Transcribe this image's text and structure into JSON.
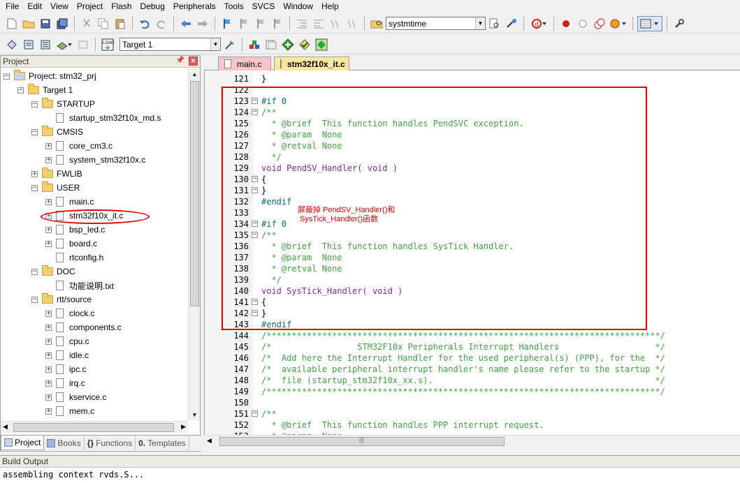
{
  "menu": [
    "File",
    "Edit",
    "View",
    "Project",
    "Flash",
    "Debug",
    "Peripherals",
    "Tools",
    "SVCS",
    "Window",
    "Help"
  ],
  "toolbar": {
    "find_combo": "systmtime",
    "target_combo": "Target 1"
  },
  "project_panel": {
    "title": "Project",
    "tree": [
      {
        "label": "Project: stm32_prj",
        "level": 0,
        "kind": "project"
      },
      {
        "label": "Target 1",
        "level": 1,
        "kind": "target"
      },
      {
        "label": "STARTUP",
        "level": 2,
        "kind": "folder"
      },
      {
        "label": "startup_stm32f10x_md.s",
        "level": 3,
        "kind": "file"
      },
      {
        "label": "CMSIS",
        "level": 2,
        "kind": "folder"
      },
      {
        "label": "core_cm3.c",
        "level": 3,
        "kind": "file"
      },
      {
        "label": "system_stm32f10x.c",
        "level": 3,
        "kind": "file"
      },
      {
        "label": "FWLIB",
        "level": 2,
        "kind": "folder"
      },
      {
        "label": "USER",
        "level": 2,
        "kind": "folder"
      },
      {
        "label": "main.c",
        "level": 3,
        "kind": "file"
      },
      {
        "label": "stm32f10x_it.c",
        "level": 3,
        "kind": "file",
        "selected": true
      },
      {
        "label": "bsp_led.c",
        "level": 3,
        "kind": "file"
      },
      {
        "label": "board.c",
        "level": 3,
        "kind": "file"
      },
      {
        "label": "rtconfig.h",
        "level": 3,
        "kind": "file"
      },
      {
        "label": "DOC",
        "level": 2,
        "kind": "folder"
      },
      {
        "label": "功能说明.txt",
        "level": 3,
        "kind": "file"
      },
      {
        "label": "rtt/source",
        "level": 2,
        "kind": "folder"
      },
      {
        "label": "clock.c",
        "level": 3,
        "kind": "file"
      },
      {
        "label": "components.c",
        "level": 3,
        "kind": "file"
      },
      {
        "label": "cpu.c",
        "level": 3,
        "kind": "file"
      },
      {
        "label": "idle.c",
        "level": 3,
        "kind": "file"
      },
      {
        "label": "ipc.c",
        "level": 3,
        "kind": "file"
      },
      {
        "label": "irq.c",
        "level": 3,
        "kind": "file"
      },
      {
        "label": "kservice.c",
        "level": 3,
        "kind": "file"
      },
      {
        "label": "mem.c",
        "level": 3,
        "kind": "file"
      }
    ],
    "tabs": [
      "Project",
      "Books",
      "Functions",
      "Templates"
    ]
  },
  "editor": {
    "tabs": [
      "main.c",
      "stm32f10x_it.c"
    ],
    "active_tab": "stm32f10x_it.c",
    "annotation": "屏蔽掉 PendSV_Handler()和\n SysTick_Handler()函数",
    "lines": [
      {
        "n": "121",
        "t": "}"
      },
      {
        "n": "122",
        "t": ""
      },
      {
        "n": "123",
        "t": "#if 0",
        "fold": true
      },
      {
        "n": "124",
        "t": "/**",
        "fold": true
      },
      {
        "n": "125",
        "t": "  * @brief  This function handles PendSVC exception."
      },
      {
        "n": "126",
        "t": "  * @param  None"
      },
      {
        "n": "127",
        "t": "  * @retval None"
      },
      {
        "n": "128",
        "t": "  */"
      },
      {
        "n": "129",
        "t": "void PendSV_Handler( void )"
      },
      {
        "n": "130",
        "t": "{",
        "fold": true
      },
      {
        "n": "131",
        "t": "}",
        "fold": true
      },
      {
        "n": "132",
        "t": "#endif"
      },
      {
        "n": "133",
        "t": ""
      },
      {
        "n": "134",
        "t": "#if 0",
        "fold": true
      },
      {
        "n": "135",
        "t": "/**",
        "fold": true
      },
      {
        "n": "136",
        "t": "  * @brief  This function handles SysTick Handler."
      },
      {
        "n": "137",
        "t": "  * @param  None"
      },
      {
        "n": "138",
        "t": "  * @retval None"
      },
      {
        "n": "139",
        "t": "  */"
      },
      {
        "n": "140",
        "t": "void SysTick_Handler( void )"
      },
      {
        "n": "141",
        "t": "{",
        "fold": true
      },
      {
        "n": "142",
        "t": "}",
        "fold": true
      },
      {
        "n": "143",
        "t": "#endif"
      },
      {
        "n": "144",
        "t": "/******************************************************************************/"
      },
      {
        "n": "145",
        "t": "/*                 STM32F10x Peripherals Interrupt Handlers                   */"
      },
      {
        "n": "146",
        "t": "/*  Add here the Interrupt Handler for the used peripheral(s) (PPP), for the  */"
      },
      {
        "n": "147",
        "t": "/*  available peripheral interrupt handler's name please refer to the startup */"
      },
      {
        "n": "148",
        "t": "/*  file (startup_stm32f10x_xx.s).                                            */"
      },
      {
        "n": "149",
        "t": "/******************************************************************************/"
      },
      {
        "n": "150",
        "t": ""
      },
      {
        "n": "151",
        "t": "/**",
        "fold": true
      },
      {
        "n": "152",
        "t": "  * @brief  This function handles PPP interrupt request."
      },
      {
        "n": "153",
        "t": "  * @param  None"
      }
    ]
  },
  "build_output": {
    "title": "Build Output",
    "text": "assembling context rvds.S..."
  }
}
